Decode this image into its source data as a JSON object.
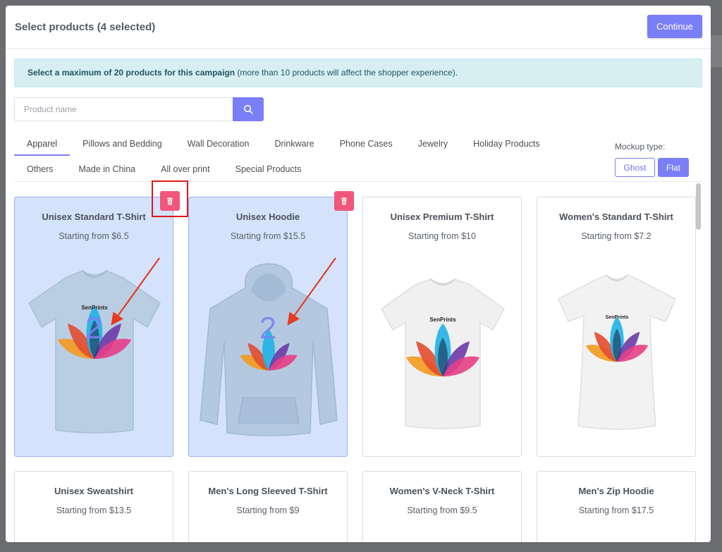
{
  "modal": {
    "title": "Select products (4 selected)",
    "continue_label": "Continue"
  },
  "alert": {
    "bold": "Select a maximum of 20 products for this campaign",
    "rest": " (more than 10 products will affect the shopper experience)."
  },
  "search": {
    "placeholder": "Product name",
    "value": "",
    "icon": "search-icon"
  },
  "tabs_row1": [
    "Apparel",
    "Pillows and Bedding",
    "Wall Decoration",
    "Drinkware",
    "Phone Cases",
    "Jewelry",
    "Holiday Products"
  ],
  "tabs_row2": [
    "Others",
    "Made in China",
    "All over print",
    "Special Products"
  ],
  "active_tab": "Apparel",
  "mockup": {
    "label": "Mockup type:",
    "options": [
      "Ghost",
      "Flat"
    ],
    "selected": "Flat"
  },
  "products": [
    {
      "name": "Unisex Standard T-Shirt",
      "price": "Starting from $6.5",
      "selected": true,
      "image": "tshirt",
      "color": "#b9cde3",
      "overlay_number": "2"
    },
    {
      "name": "Unisex Hoodie",
      "price": "Starting from $15.5",
      "selected": true,
      "image": "hoodie",
      "color": "#b4c9e0",
      "overlay_number": "2"
    },
    {
      "name": "Unisex Premium T-Shirt",
      "price": "Starting from $10",
      "selected": false,
      "image": "tshirt",
      "color": "#f0f0f0"
    },
    {
      "name": "Women's Standard T-Shirt",
      "price": "Starting from $7.2",
      "selected": false,
      "image": "tshirt-women",
      "color": "#f2f2f2"
    },
    {
      "name": "Unisex Sweatshirt",
      "price": "Starting from $13.5",
      "selected": false
    },
    {
      "name": "Men's Long Sleeved T-Shirt",
      "price": "Starting from $9",
      "selected": false
    },
    {
      "name": "Women's V-Neck T-Shirt",
      "price": "Starting from $9.5",
      "selected": false
    },
    {
      "name": "Men's Zip Hoodie",
      "price": "Starting from $17.5",
      "selected": false
    }
  ],
  "print_logo": "SenPrints",
  "colors": {
    "accent": "#7a7ef7",
    "delete": "#f0577b",
    "selected_bg": "#d4e3fb",
    "annotation_red": "#e11818"
  }
}
